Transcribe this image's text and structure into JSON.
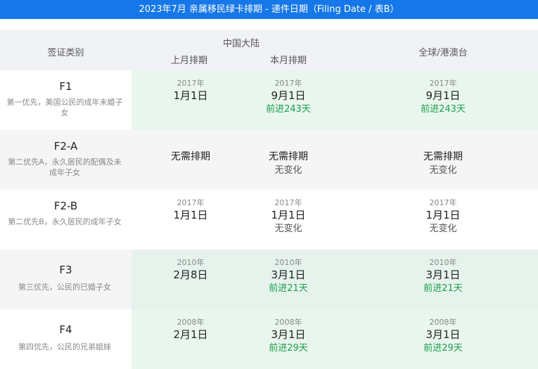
{
  "title": "2023年7月 亲属移民绿卡排期 - 递件日期（Filing Date / 表B）",
  "header": {
    "category": "签证类别",
    "china": "中国大陆",
    "last_month": "上月排期",
    "this_month": "本月排期",
    "global": "全球/港澳台"
  },
  "colors": {
    "title_bg": "#1677e8",
    "header_bg": "#f0f2f5",
    "green_bg": "#e9f6ee",
    "gray_bg": "#f5f5f5",
    "advance_text": "#1a9e4b"
  },
  "rows": [
    {
      "code": "F1",
      "desc": "第一优先，美国公民的成年未婚子女",
      "last": {
        "year": "2017年",
        "date": "1月1日"
      },
      "this": {
        "year": "2017年",
        "date": "9月1日",
        "note": "前进243天"
      },
      "global": {
        "year": "2017年",
        "date": "9月1日",
        "note": "前进243天"
      }
    },
    {
      "code": "F2-A",
      "desc": "第二优先A，永久居民的配偶及未成年子女",
      "last": {
        "text": "无需排期"
      },
      "this": {
        "text": "无需排期",
        "note": "无变化"
      },
      "global": {
        "text": "无需排期",
        "note": "无变化"
      }
    },
    {
      "code": "F2-B",
      "desc": "第二优先B，永久居民的成年子女",
      "last": {
        "year": "2017年",
        "date": "1月1日"
      },
      "this": {
        "year": "2017年",
        "date": "1月1日",
        "note": "无变化"
      },
      "global": {
        "year": "2017年",
        "date": "1月1日",
        "note": "无变化"
      }
    },
    {
      "code": "F3",
      "desc": "第三优先，公民的已婚子女",
      "last": {
        "year": "2010年",
        "date": "2月8日"
      },
      "this": {
        "year": "2010年",
        "date": "3月1日",
        "note": "前进21天"
      },
      "global": {
        "year": "2010年",
        "date": "3月1日",
        "note": "前进21天"
      }
    },
    {
      "code": "F4",
      "desc": "第四优先，公民的兄弟姐妹",
      "last": {
        "year": "2008年",
        "date": "2月1日"
      },
      "this": {
        "year": "2008年",
        "date": "3月1日",
        "note": "前进29天"
      },
      "global": {
        "year": "2008年",
        "date": "3月1日",
        "note": "前进29天"
      }
    }
  ]
}
